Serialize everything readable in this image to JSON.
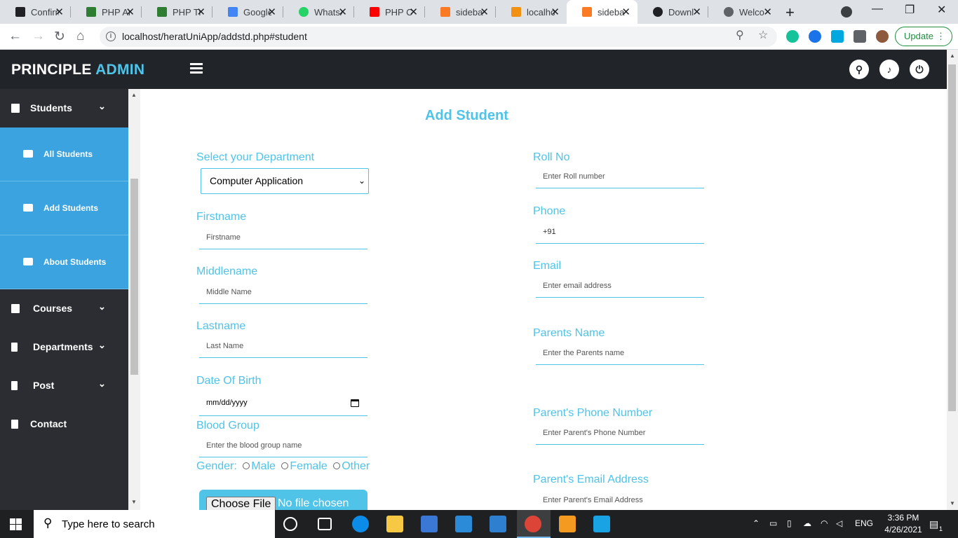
{
  "browser": {
    "tabs": [
      {
        "label": "Confirm",
        "color": "#202124"
      },
      {
        "label": "PHP Ar",
        "color": "#2e7d32"
      },
      {
        "label": "PHP Tr",
        "color": "#2e7d32"
      },
      {
        "label": "Google",
        "color": "#4285f4"
      },
      {
        "label": "WhatsA",
        "color": "#25d366"
      },
      {
        "label": "PHP CI",
        "color": "#ff0000"
      },
      {
        "label": "sideba",
        "color": "#fb7a24"
      },
      {
        "label": "localho",
        "color": "#f29111"
      },
      {
        "label": "sideba",
        "color": "#fb7a24",
        "active": true
      },
      {
        "label": "Downl",
        "color": "#202124"
      },
      {
        "label": "Welco",
        "color": "#5f6368"
      }
    ],
    "url": "localhost/heratUniApp/addstd.php#student",
    "update_label": "Update"
  },
  "header": {
    "brand_main": "PRINCIPLE",
    "brand_accent": "ADMIN"
  },
  "sidebar": {
    "students": "Students",
    "all_students": "All Students",
    "add_students": "Add Students",
    "about_students": "About Students",
    "courses": "Courses",
    "departments": "Departments",
    "post": "Post",
    "contact": "Contact"
  },
  "form": {
    "title": "Add Student",
    "department_label": "Select your Department",
    "department_value": "Computer Application",
    "firstname_label": "Firstname",
    "firstname_placeholder": "Firstname",
    "middlename_label": "Middlename",
    "middlename_placeholder": "Middle Name",
    "lastname_label": "Lastname",
    "lastname_placeholder": "Last Name",
    "dob_label": "Date Of Birth",
    "dob_placeholder": "mm/dd/yyyy",
    "blood_label": "Blood Group",
    "blood_placeholder": "Enter the blood group name",
    "gender_label": "Gender:",
    "gender_options": [
      "Male",
      "Female",
      "Other"
    ],
    "file_button": "Choose File",
    "file_status": "No file chosen",
    "roll_label": "Roll No",
    "roll_placeholder": "Enter Roll number",
    "phone_label": "Phone",
    "phone_value": "+91",
    "email_label": "Email",
    "email_placeholder": "Enter email address",
    "parents_label": "Parents Name",
    "parents_placeholder": "Enter the Parents name",
    "parent_phone_label": "Parent's Phone Number",
    "parent_phone_placeholder": "Enter Parent's Phone Number",
    "parent_email_label": "Parent's Email Address",
    "parent_email_placeholder": "Enter Parent's Email Address"
  },
  "taskbar": {
    "search_text": "Type here to search",
    "language": "ENG",
    "time": "3:36 PM",
    "date": "4/26/2021",
    "notification_count": "1"
  }
}
